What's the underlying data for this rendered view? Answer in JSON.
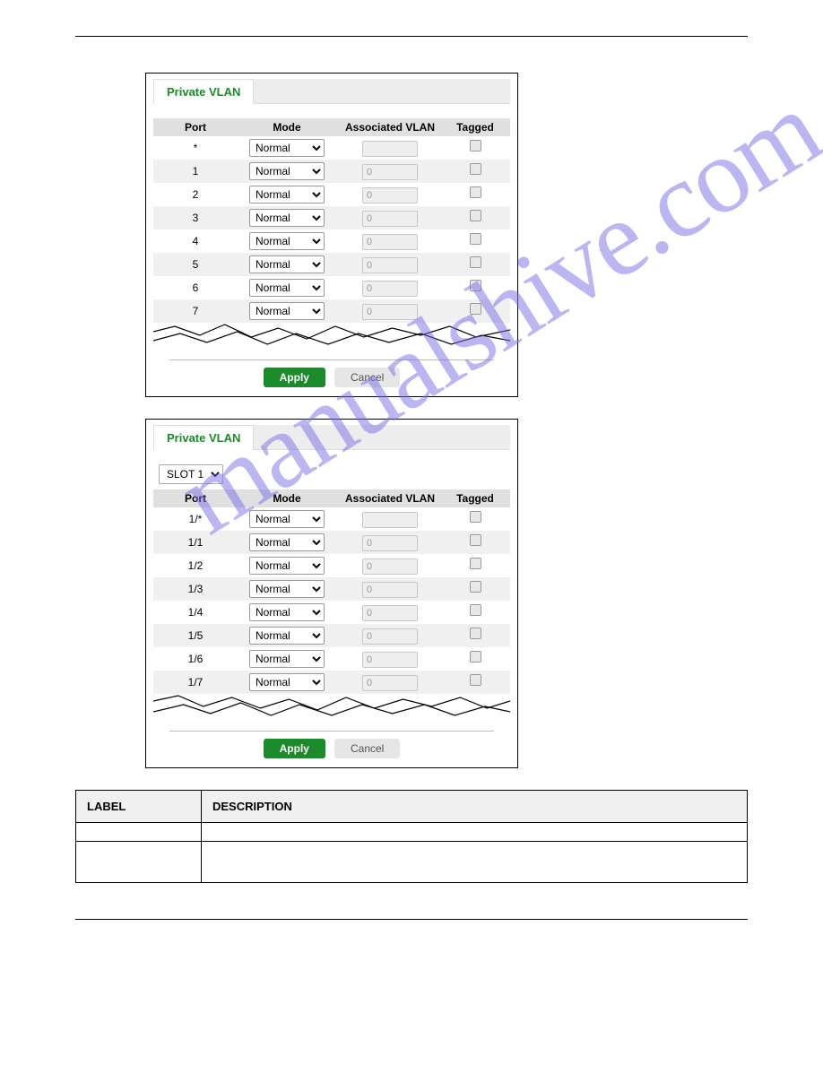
{
  "watermark": "manualshive.com",
  "panel1": {
    "tab": "Private VLAN",
    "columns": {
      "port": "Port",
      "mode": "Mode",
      "vlan": "Associated VLAN",
      "tagged": "Tagged"
    },
    "mode_option": "Normal",
    "vlan_placeholder": "0",
    "rows": [
      {
        "port": "*",
        "blank_vlan": true
      },
      {
        "port": "1",
        "blank_vlan": false
      },
      {
        "port": "2",
        "blank_vlan": false
      },
      {
        "port": "3",
        "blank_vlan": false
      },
      {
        "port": "4",
        "blank_vlan": false
      },
      {
        "port": "5",
        "blank_vlan": false
      },
      {
        "port": "6",
        "blank_vlan": false
      },
      {
        "port": "7",
        "blank_vlan": false
      }
    ],
    "apply": "Apply",
    "cancel": "Cancel"
  },
  "panel2": {
    "tab": "Private VLAN",
    "slot_option": "SLOT 1",
    "columns": {
      "port": "Port",
      "mode": "Mode",
      "vlan": "Associated VLAN",
      "tagged": "Tagged"
    },
    "mode_option": "Normal",
    "vlan_placeholder": "0",
    "rows": [
      {
        "port": "1/*",
        "blank_vlan": true
      },
      {
        "port": "1/1",
        "blank_vlan": false
      },
      {
        "port": "1/2",
        "blank_vlan": false
      },
      {
        "port": "1/3",
        "blank_vlan": false
      },
      {
        "port": "1/4",
        "blank_vlan": false
      },
      {
        "port": "1/5",
        "blank_vlan": false
      },
      {
        "port": "1/6",
        "blank_vlan": false
      },
      {
        "port": "1/7",
        "blank_vlan": false
      }
    ],
    "apply": "Apply",
    "cancel": "Cancel"
  },
  "desc": {
    "head_label": "LABEL",
    "head_desc": "DESCRIPTION",
    "rows": [
      {
        "label": "",
        "desc": ""
      },
      {
        "label": "",
        "desc": ""
      }
    ]
  }
}
